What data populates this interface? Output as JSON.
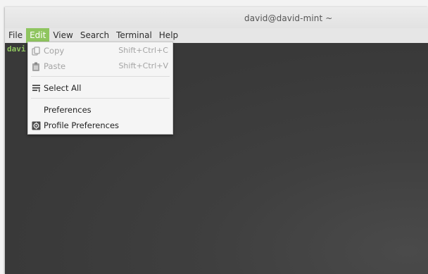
{
  "window": {
    "title": "david@david-mint ~"
  },
  "menubar": {
    "items": [
      {
        "label": "File"
      },
      {
        "label": "Edit"
      },
      {
        "label": "View"
      },
      {
        "label": "Search"
      },
      {
        "label": "Terminal"
      },
      {
        "label": "Help"
      }
    ]
  },
  "terminal": {
    "prompt_partial": "davi"
  },
  "edit_menu": {
    "items": [
      {
        "label": "Copy",
        "shortcut": "Shift+Ctrl+C",
        "icon": "copy-icon",
        "enabled": false
      },
      {
        "label": "Paste",
        "shortcut": "Shift+Ctrl+V",
        "icon": "paste-icon",
        "enabled": false
      },
      {
        "label": "Select All",
        "shortcut": "",
        "icon": "select-all-icon",
        "enabled": true
      },
      {
        "label": "Preferences",
        "shortcut": "",
        "icon": "",
        "enabled": true
      },
      {
        "label": "Profile Preferences",
        "shortcut": "",
        "icon": "profile-preferences-icon",
        "enabled": true
      }
    ]
  },
  "colors": {
    "accent": "#8fc55f",
    "terminal_bg": "#3c3c3c",
    "menu_bg": "#f5f5f5"
  }
}
